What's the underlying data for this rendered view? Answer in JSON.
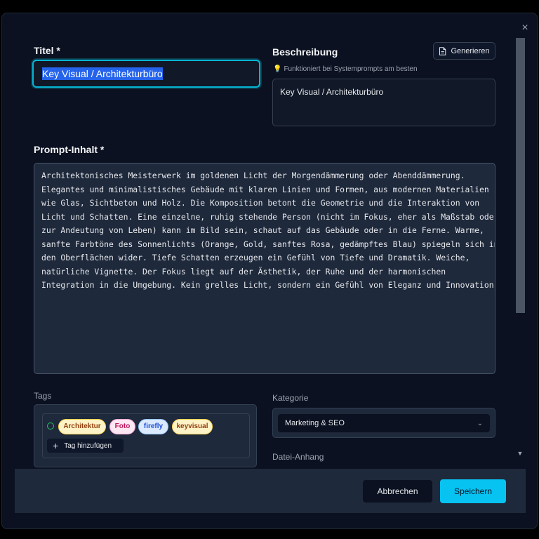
{
  "dialog": {
    "close_label": "×"
  },
  "title_field": {
    "label": "Titel *",
    "value": "Key Visual / Architekturbüro"
  },
  "description": {
    "label": "Beschreibung",
    "generate_label": "Generieren",
    "hint": "Funktioniert bei Systemprompts am besten",
    "value": "Key Visual / Architekturbüro"
  },
  "prompt": {
    "label": "Prompt-Inhalt *",
    "value": "Architektonisches Meisterwerk im goldenen Licht der Morgendämmerung oder Abenddämmerung.\nElegantes und minimalistisches Gebäude mit klaren Linien und Formen, aus modernen Materialien\nwie Glas, Sichtbeton und Holz. Die Komposition betont die Geometrie und die Interaktion von\nLicht und Schatten. Eine einzelne, ruhig stehende Person (nicht im Fokus, eher als Maßstab oder\nzur Andeutung von Leben) kann im Bild sein, schaut auf das Gebäude oder in die Ferne. Warme,\nsanfte Farbtöne des Sonnenlichts (Orange, Gold, sanftes Rosa, gedämpftes Blau) spiegeln sich in\nden Oberflächen wider. Tiefe Schatten erzeugen ein Gefühl von Tiefe und Dramatik. Weiche,\nnatürliche Vignette. Der Fokus liegt auf der Ästhetik, der Ruhe und der harmonischen\nIntegration in die Umgebung. Kein grelles Licht, sondern ein Gefühl von Eleganz und Innovation."
  },
  "tags": {
    "label": "Tags",
    "items": [
      "Architektur",
      "Foto",
      "firefly",
      "keyvisual"
    ],
    "add_label": "Tag hinzufügen"
  },
  "category": {
    "label": "Kategorie",
    "selected": "Marketing & SEO"
  },
  "attachment": {
    "label": "Datei-Anhang"
  },
  "footer": {
    "cancel_label": "Abbrechen",
    "save_label": "Speichern"
  },
  "colors": {
    "accent": "#06b6d4",
    "save_button": "#06c3f2",
    "background": "#0b1120",
    "panel": "#1e293b"
  }
}
